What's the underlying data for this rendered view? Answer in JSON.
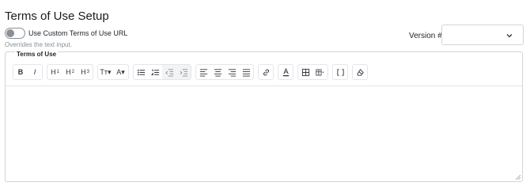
{
  "page": {
    "title": "Terms of Use Setup"
  },
  "toggle": {
    "label": "Use Custom Terms of Use URL",
    "help": "Overrides the text input.",
    "checked": false
  },
  "version": {
    "label": "Version #",
    "value": ""
  },
  "editor": {
    "label": "Terms of Use",
    "content": "",
    "toolbar": {
      "bold": "B",
      "italic": "I",
      "h1": "H",
      "h1_sub": "1",
      "h2": "H",
      "h2_sub": "2",
      "h3": "H",
      "h3_sub": "3",
      "text_size": "Tт▾",
      "font_style": "A▾"
    }
  }
}
